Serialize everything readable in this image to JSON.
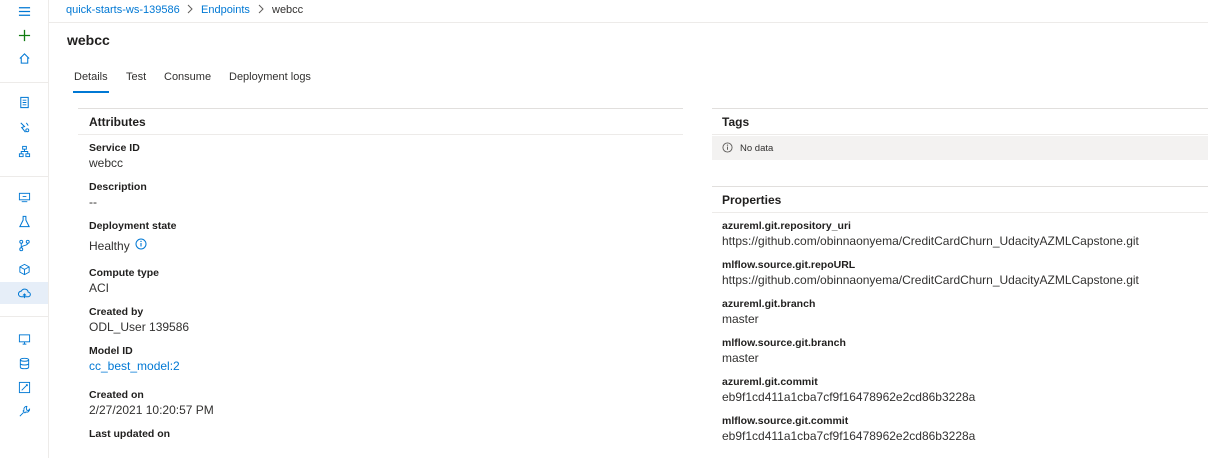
{
  "breadcrumb": {
    "workspace": "quick-starts-ws-139586",
    "section": "Endpoints",
    "current": "webcc"
  },
  "page": {
    "title": "webcc"
  },
  "tabs": [
    "Details",
    "Test",
    "Consume",
    "Deployment logs"
  ],
  "active_tab": "Details",
  "attributes": {
    "heading": "Attributes",
    "service_id_label": "Service ID",
    "service_id": "webcc",
    "description_label": "Description",
    "description": "--",
    "deployment_state_label": "Deployment state",
    "deployment_state": "Healthy",
    "compute_type_label": "Compute type",
    "compute_type": "ACI",
    "created_by_label": "Created by",
    "created_by": "ODL_User 139586",
    "model_id_label": "Model ID",
    "model_id": "cc_best_model:2",
    "created_on_label": "Created on",
    "created_on": "2/27/2021 10:20:57 PM",
    "last_updated_label": "Last updated on"
  },
  "tags": {
    "heading": "Tags",
    "empty": "No data"
  },
  "properties": {
    "heading": "Properties",
    "items": [
      {
        "key": "azureml.git.repository_uri",
        "value": "https://github.com/obinnaonyema/CreditCardChurn_UdacityAZMLCapstone.git"
      },
      {
        "key": "mlflow.source.git.repoURL",
        "value": "https://github.com/obinnaonyema/CreditCardChurn_UdacityAZMLCapstone.git"
      },
      {
        "key": "azureml.git.branch",
        "value": "master"
      },
      {
        "key": "mlflow.source.git.branch",
        "value": "master"
      },
      {
        "key": "azureml.git.commit",
        "value": "eb9f1cd411a1cba7cf9f16478962e2cd86b3228a"
      },
      {
        "key": "mlflow.source.git.commit",
        "value": "eb9f1cd411a1cba7cf9f16478962e2cd86b3228a"
      }
    ]
  },
  "nav_icons": [
    "hamburger-icon",
    "plus-icon",
    "home-icon",
    "notebook-icon",
    "automl-icon",
    "designer-icon",
    "datasets-icon",
    "experiments-icon",
    "pipelines-icon",
    "models-icon",
    "endpoints-icon",
    "compute-icon",
    "datastores-icon",
    "labeling-icon",
    "linked-services-icon"
  ],
  "colors": {
    "accent": "#0078d4",
    "plus": "#107c10",
    "text": "#323130"
  }
}
